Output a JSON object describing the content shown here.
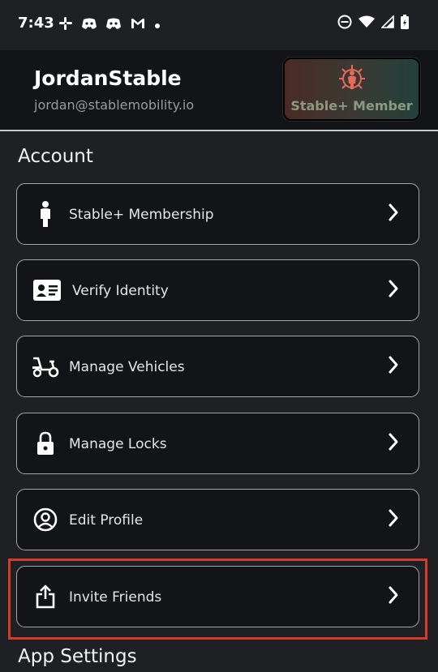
{
  "status_bar": {
    "time": "7:43",
    "notification_icons": [
      "slack-icon",
      "discord-icon",
      "discord-icon",
      "gmail-icon",
      "dot-icon"
    ],
    "system_icons": [
      "dnd-icon",
      "wifi-icon",
      "signal-icon",
      "battery-icon"
    ]
  },
  "profile": {
    "username": "JordanStable",
    "email": "jordan@stablemobility.io",
    "badge_label": "Stable+ Member"
  },
  "sections": {
    "account_title": "Account",
    "app_settings_title": "App Settings"
  },
  "account_items": [
    {
      "label": "Stable+ Membership",
      "icon": "person-icon"
    },
    {
      "label": "Verify Identity",
      "icon": "id-card-icon"
    },
    {
      "label": "Manage Vehicles",
      "icon": "scooter-icon"
    },
    {
      "label": "Manage Locks",
      "icon": "lock-icon"
    },
    {
      "label": "Edit Profile",
      "icon": "user-circle-icon"
    },
    {
      "label": "Invite Friends",
      "icon": "share-icon"
    }
  ],
  "colors": {
    "background": "#1f2024",
    "card": "#131417",
    "card_border": "#a7a7aa",
    "highlight": "#d73a2a",
    "badge_icon": "#e9695b"
  }
}
